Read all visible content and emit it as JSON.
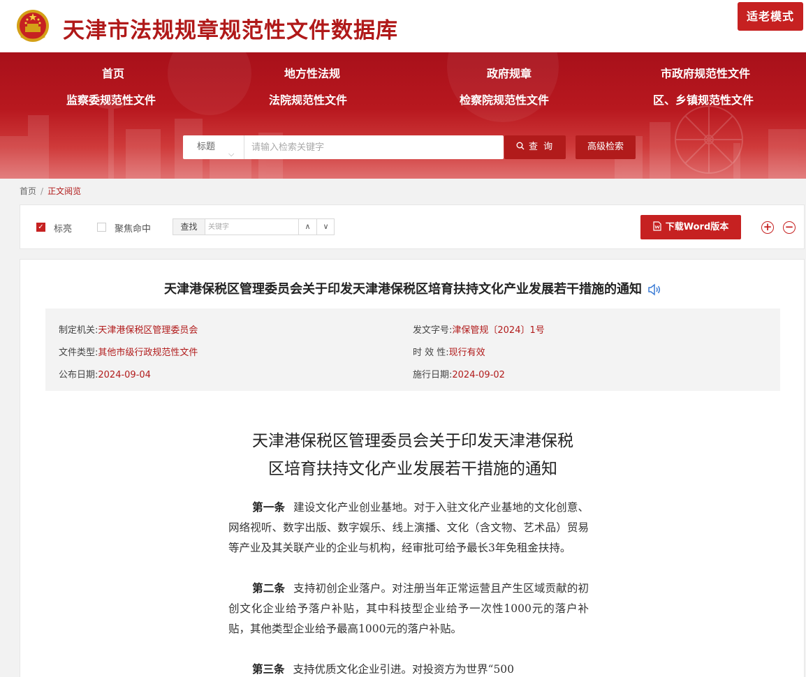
{
  "header": {
    "title": "天津市法规规章规范性文件数据库",
    "elder_mode": "适老模式"
  },
  "nav": {
    "row1": [
      "首页",
      "地方性法规",
      "政府规章",
      "市政府规范性文件"
    ],
    "row2": [
      "监察委规范性文件",
      "法院规范性文件",
      "检察院规范性文件",
      "区、乡镇规范性文件"
    ]
  },
  "search": {
    "type": "标题",
    "placeholder": "请输入检索关键字",
    "query_button": "查 询",
    "advanced_button": "高级检索"
  },
  "breadcrumb": {
    "home": "首页",
    "sep": "/",
    "current": "正文阅览"
  },
  "toolbar": {
    "highlight_label": "标亮",
    "highlight_checked": true,
    "focus_label": "聚焦命中",
    "focus_checked": false,
    "find_label": "查找",
    "find_placeholder": "关键字",
    "up_arrow": "∧",
    "down_arrow": "∨",
    "word_button": "下载Word版本",
    "zoom_in": "+",
    "zoom_out": "−"
  },
  "document": {
    "title": "天津港保税区管理委员会关于印发天津港保税区培育扶持文化产业发展若干措施的通知",
    "meta": {
      "issuer_key": "制定机关:",
      "issuer": "天津港保税区管理委员会",
      "doc_no_key": "发文字号:",
      "doc_no": "津保管规〔2024〕1号",
      "type_key": "文件类型:",
      "type": "其他市级行政规范性文件",
      "validity_key": "时 效 性:",
      "validity": "现行有效",
      "publish_key": "公布日期:",
      "publish_date": "2024-09-04",
      "effective_key": "施行日期:",
      "effective_date": "2024-09-02"
    },
    "body_title_line1": "天津港保税区管理委员会关于印发天津港保税",
    "body_title_line2": "区培育扶持文化产业发展若干措施的通知",
    "articles": [
      {
        "num": "第一条",
        "text": "建设文化产业创业基地。对于入驻文化产业基地的文化创意、网络视听、数字出版、数字娱乐、线上演播、文化（含文物、艺术品）贸易等产业及其关联产业的企业与机构，经审批可给予最长3年免租金扶持。"
      },
      {
        "num": "第二条",
        "text": "支持初创企业落户。对注册当年正常运营且产生区域贡献的初创文化企业给予落户补贴，其中科技型企业给予一次性1000元的落户补贴，其他类型企业给予最高1000元的落户补贴。"
      },
      {
        "num": "第三条",
        "text": "支持优质文化企业引进。对投资方为世界“500"
      }
    ]
  },
  "colors": {
    "brand_red": "#b01919",
    "button_red": "#c62121",
    "banner_red": "#b8181f"
  }
}
